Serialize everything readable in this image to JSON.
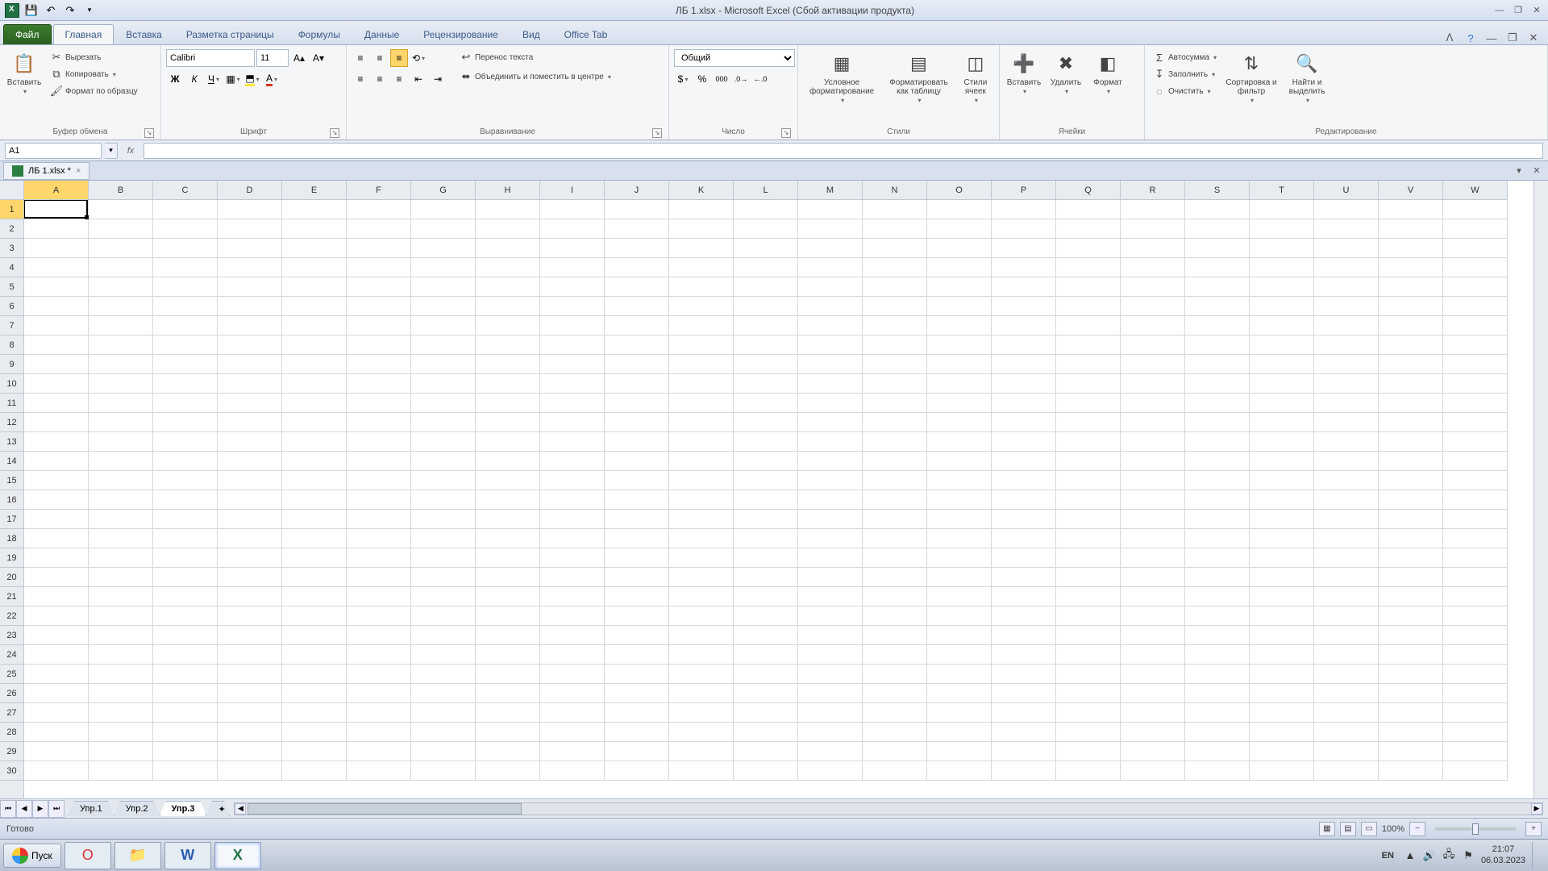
{
  "title": "ЛБ 1.xlsx - Microsoft Excel (Сбой активации продукта)",
  "tabs": {
    "file": "Файл",
    "items": [
      "Главная",
      "Вставка",
      "Разметка страницы",
      "Формулы",
      "Данные",
      "Рецензирование",
      "Вид",
      "Office Tab"
    ],
    "active": "Главная"
  },
  "clipboard": {
    "paste": "Вставить",
    "cut": "Вырезать",
    "copy": "Копировать",
    "fmt": "Формат по образцу",
    "label": "Буфер обмена"
  },
  "font": {
    "name": "Calibri",
    "size": "11",
    "label": "Шрифт"
  },
  "align": {
    "wrap": "Перенос текста",
    "merge": "Объединить и поместить в центре",
    "label": "Выравнивание"
  },
  "number": {
    "fmt": "Общий",
    "label": "Число"
  },
  "styles": {
    "cond": "Условное форматирование",
    "table": "Форматировать как таблицу",
    "cell": "Стили ячеек",
    "label": "Стили"
  },
  "cells": {
    "ins": "Вставить",
    "del": "Удалить",
    "fmt": "Формат",
    "label": "Ячейки"
  },
  "edit": {
    "sum": "Автосумма",
    "fill": "Заполнить",
    "clear": "Очистить",
    "sort": "Сортировка и фильтр",
    "find": "Найти и выделить",
    "label": "Редактирование"
  },
  "namebox": "A1",
  "docTabs": [
    {
      "name": "ЛБ 1.xlsx *"
    }
  ],
  "cols": [
    "A",
    "B",
    "C",
    "D",
    "E",
    "F",
    "G",
    "H",
    "I",
    "J",
    "K",
    "L",
    "M",
    "N",
    "O",
    "P",
    "Q",
    "R",
    "S",
    "T",
    "U",
    "V",
    "W"
  ],
  "rowCount": 30,
  "activeCell": {
    "col": 0,
    "row": 0
  },
  "sheets": {
    "list": [
      "Упр.1",
      "Упр.2",
      "Упр.3"
    ],
    "active": "Упр.3"
  },
  "status": "Готово",
  "zoom": "100%",
  "taskbar": {
    "start": "Пуск",
    "lang": "EN",
    "time": "21:07",
    "date": "06.03.2023"
  }
}
